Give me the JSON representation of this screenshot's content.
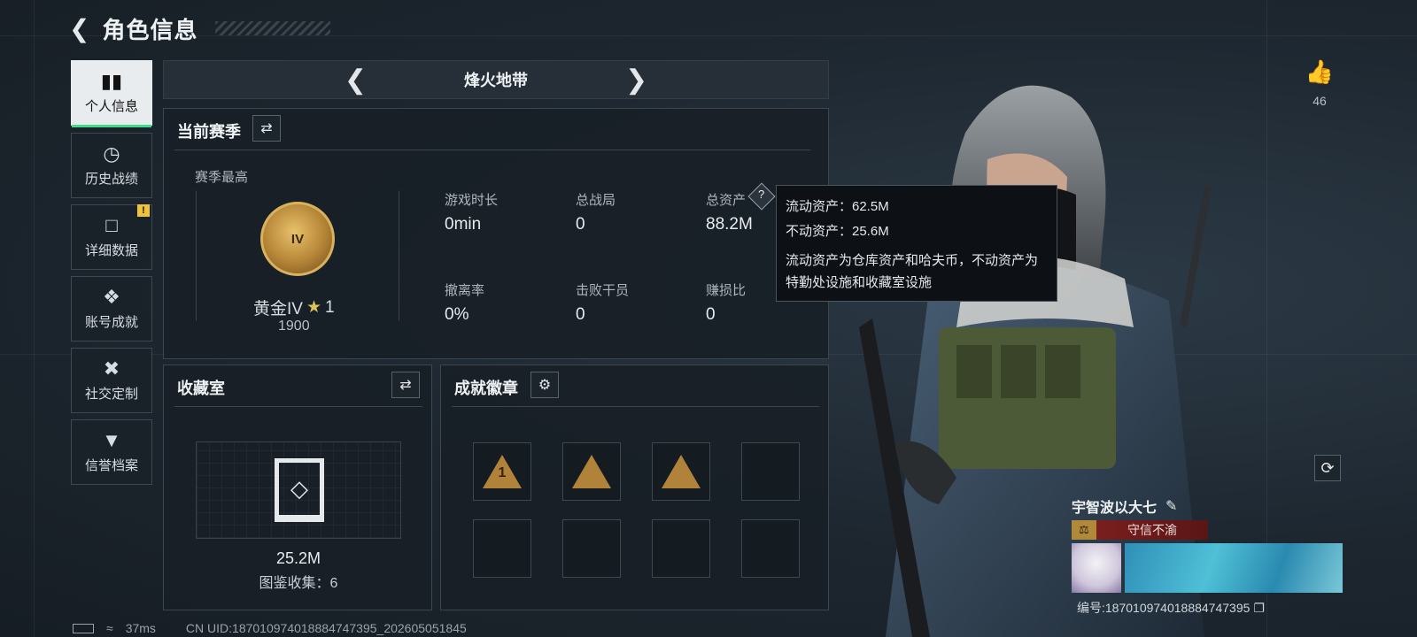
{
  "header": {
    "back_icon": "back-arrow-icon",
    "title": "角色信息"
  },
  "sidebar": [
    {
      "icon": "bar-chart-icon",
      "label": "个人信息",
      "active": true
    },
    {
      "icon": "clock-icon",
      "label": "历史战绩",
      "active": false
    },
    {
      "icon": "folder-icon",
      "label": "详细数据",
      "active": false,
      "badge": "!"
    },
    {
      "icon": "trophy-icon",
      "label": "账号成就",
      "active": false
    },
    {
      "icon": "wrench-icon",
      "label": "社交定制",
      "active": false
    },
    {
      "icon": "shield-icon",
      "label": "信誉档案",
      "active": false
    }
  ],
  "mode": {
    "title": "烽火地带"
  },
  "season": {
    "title": "当前赛季",
    "best_label": "赛季最高",
    "rank_name": "黄金IV",
    "rank_stars": "1",
    "rank_points": "1900",
    "rank_roman": "IV",
    "stats": [
      {
        "label": "游戏时长",
        "value": "0min"
      },
      {
        "label": "总战局",
        "value": "0"
      },
      {
        "label": "总资产",
        "value": "88.2M"
      },
      {
        "label": "撤离率",
        "value": "0%"
      },
      {
        "label": "击败干员",
        "value": "0"
      },
      {
        "label": "赚损比",
        "value": "0"
      }
    ]
  },
  "tooltip": {
    "liquid": "流动资产：62.5M",
    "fixed": "不动资产：25.6M",
    "desc": "流动资产为仓库资产和哈夫币，不动资产为特勤处设施和收藏室设施"
  },
  "collection": {
    "title": "收藏室",
    "value": "25.2M",
    "count_label": "图鉴收集：6"
  },
  "achievements": {
    "title": "成就徽章",
    "badges": [
      "1",
      "",
      "",
      ""
    ]
  },
  "profile": {
    "likes": "46",
    "name": "宇智波以大七",
    "reputation": "守信不渝",
    "id_label": "编号:187010974018884747395"
  },
  "status": {
    "ping": "37ms",
    "uid": "CN UID:187010974018884747395_202605051845"
  },
  "colors": {
    "accent": "#3fdc8c",
    "gold": "#d8b25c",
    "badge": "#f0c43a",
    "reputation": "#7a1e1e"
  }
}
